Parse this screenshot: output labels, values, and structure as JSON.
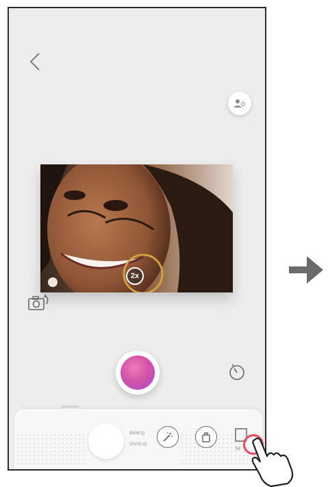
{
  "screen": {
    "zoom_badge": "2x",
    "bw_label": "B&W",
    "vivid_label": "VIVID",
    "frame_label": "Se"
  },
  "icons": {
    "back": "chevron-left-icon",
    "top_right": "person-face-icon",
    "flip": "flip-camera-icon",
    "timer": "timer-icon",
    "magic": "magic-wand-icon",
    "sticker": "sticker-icon",
    "frame": "frame-icon"
  },
  "colors": {
    "shutter_gradient": [
      "#f07ab8",
      "#a54bd3"
    ],
    "highlight": "#e8475c",
    "arrow": "#6b6b6b"
  }
}
